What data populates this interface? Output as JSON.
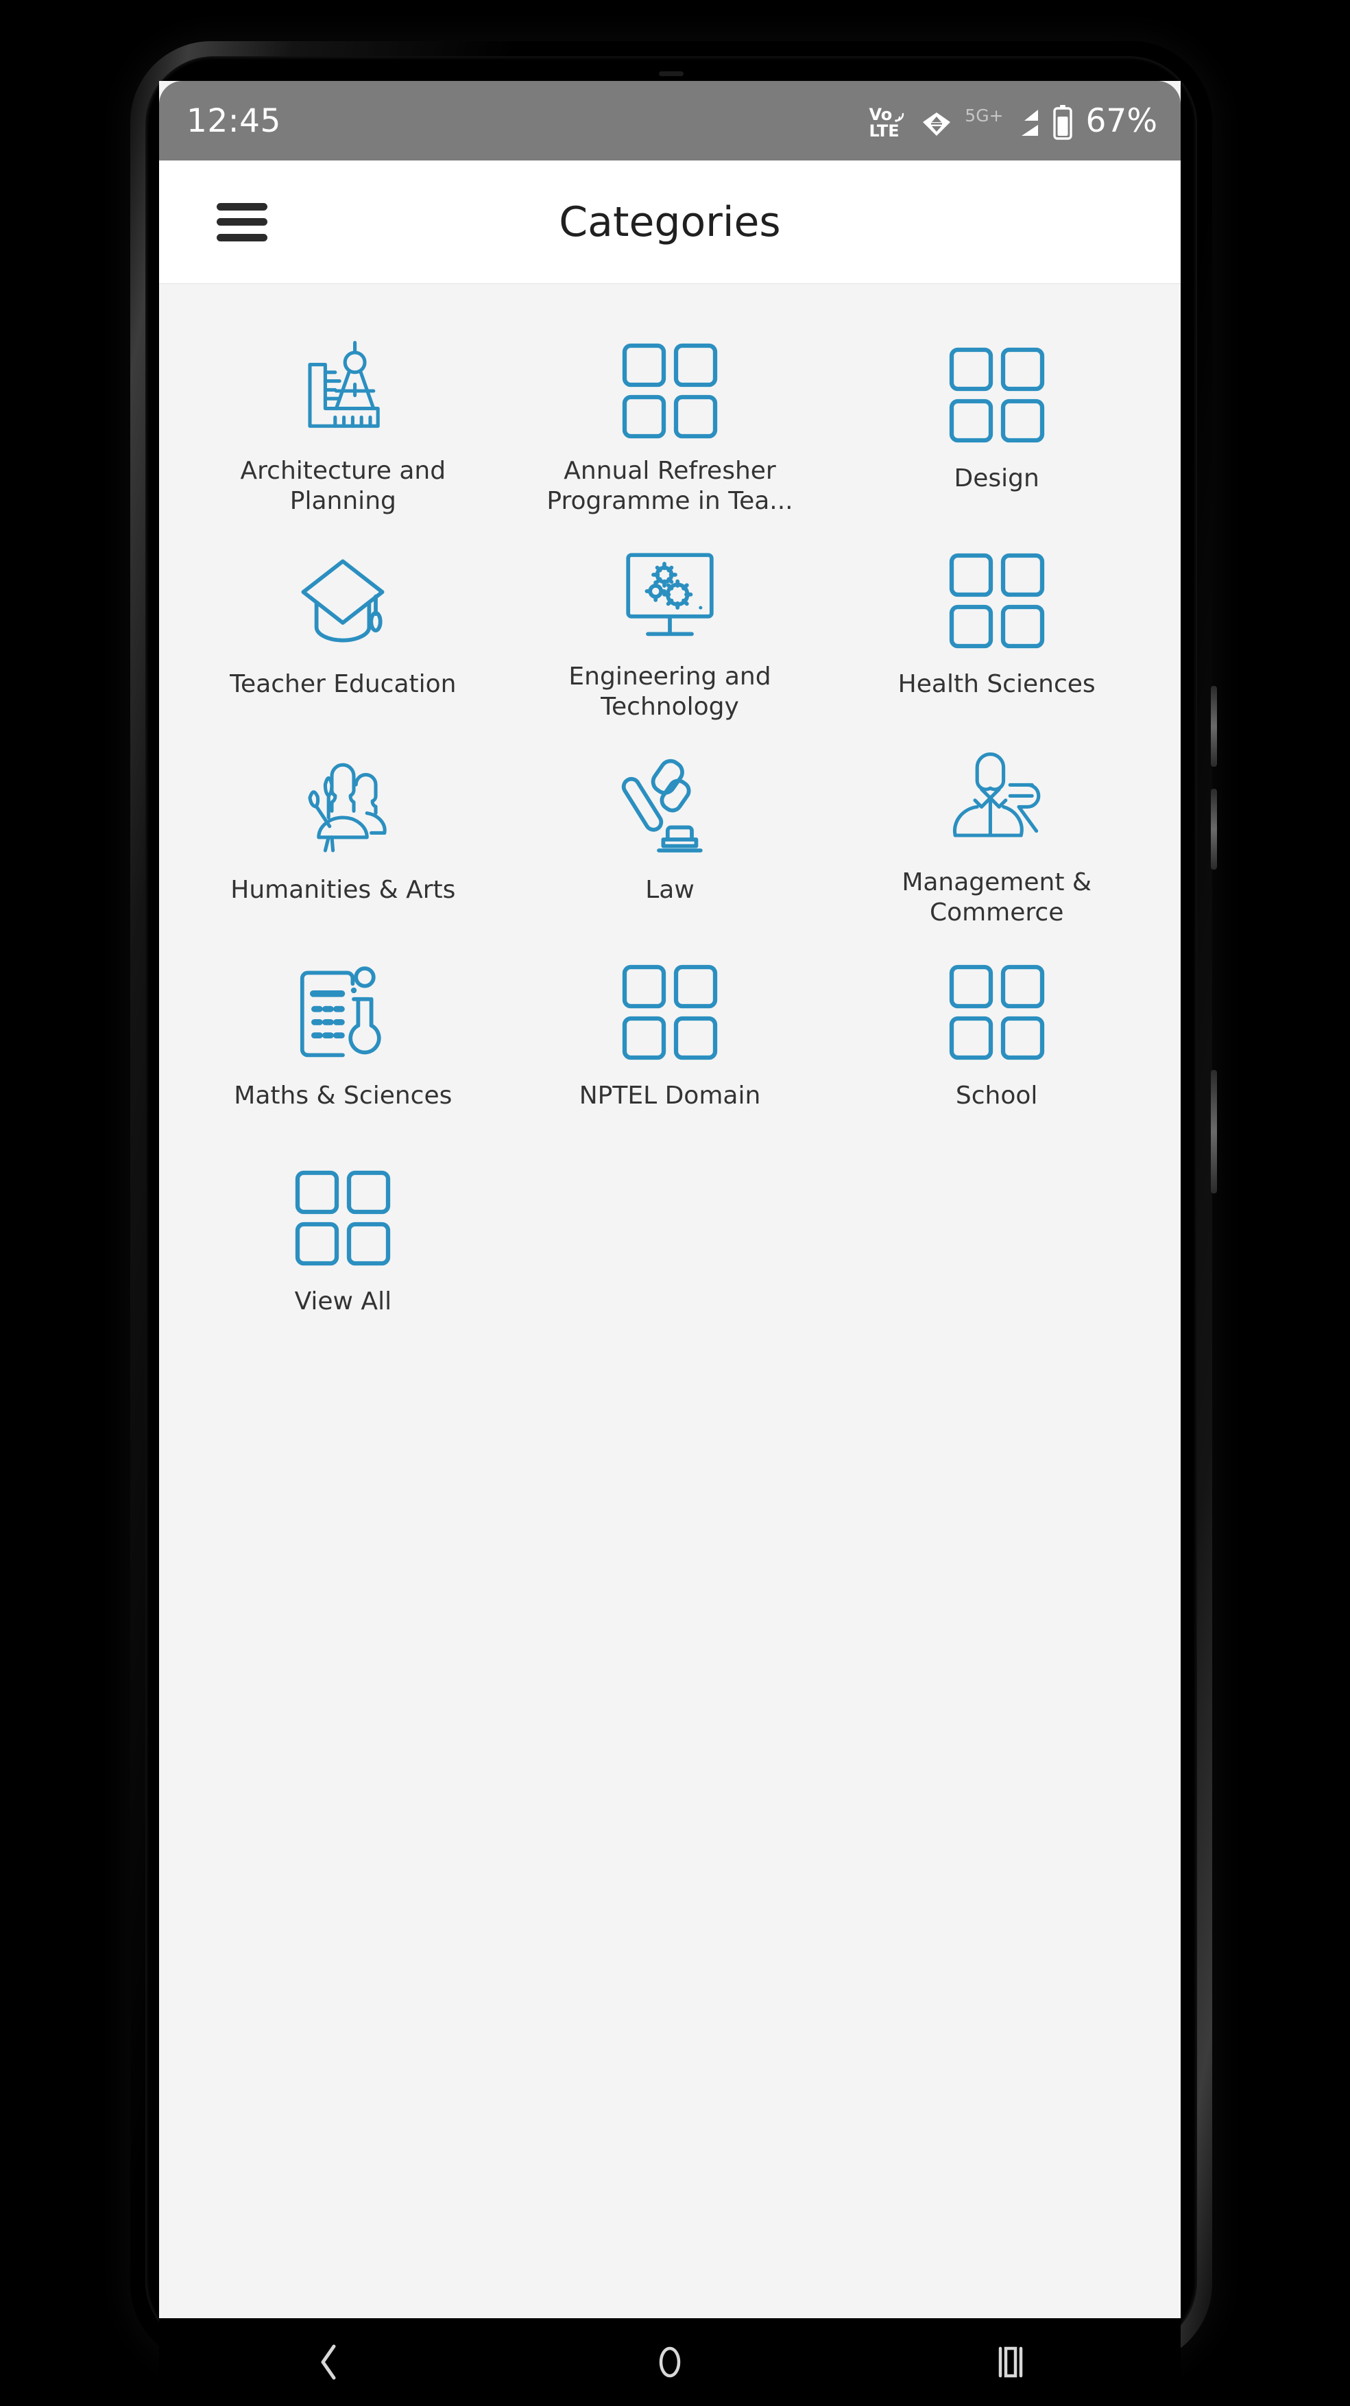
{
  "status_bar": {
    "clock": "12:45",
    "volte_top": "Vo",
    "volte_bottom": "LTE",
    "network_label": "5G+",
    "battery_percent": "67%",
    "icons": [
      "volte-icon",
      "wifi-icon",
      "signal-icon",
      "battery-icon"
    ],
    "background": "#7c7c7c"
  },
  "app_bar": {
    "title": "Categories",
    "menu_icon": "hamburger-menu-icon",
    "background": "#ffffff"
  },
  "theme": {
    "accent": "#2b8fc0",
    "content_background": "#f4f4f4",
    "label_color": "#333333"
  },
  "categories": [
    {
      "label": "Architecture and Planning",
      "icon": "compass-ruler-icon"
    },
    {
      "label": "Annual Refresher Programme in Tea...",
      "icon": "four-squares-icon"
    },
    {
      "label": "Design",
      "icon": "four-squares-icon"
    },
    {
      "label": "Teacher Education",
      "icon": "graduation-cap-icon"
    },
    {
      "label": "Engineering and Technology",
      "icon": "monitor-gears-icon"
    },
    {
      "label": "Health Sciences",
      "icon": "four-squares-icon"
    },
    {
      "label": "Humanities & Arts",
      "icon": "people-brush-icon"
    },
    {
      "label": "Law",
      "icon": "gavel-icon"
    },
    {
      "label": "Management & Commerce",
      "icon": "businessperson-rupee-icon"
    },
    {
      "label": "Maths & Sciences",
      "icon": "calculator-flask-icon"
    },
    {
      "label": "NPTEL Domain",
      "icon": "four-squares-icon"
    },
    {
      "label": "School",
      "icon": "four-squares-icon"
    },
    {
      "label": "View All",
      "icon": "four-squares-icon"
    }
  ],
  "nav_bar": {
    "back_label": "back-icon",
    "home_label": "home-icon",
    "recents_label": "recents-icon"
  }
}
